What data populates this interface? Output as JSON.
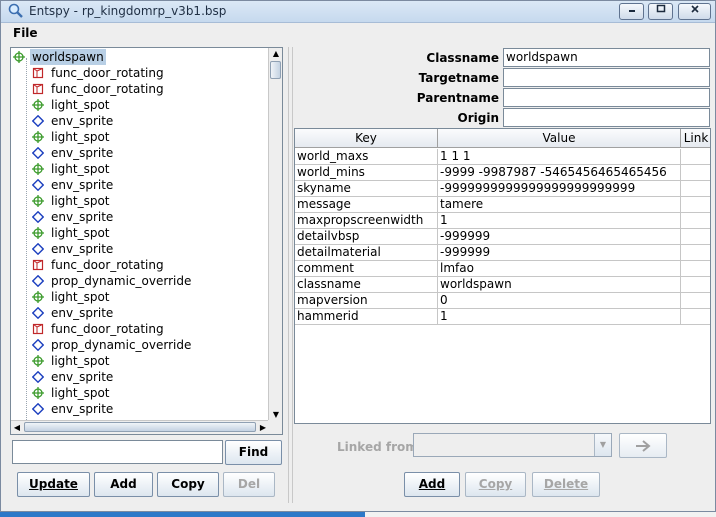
{
  "window": {
    "title": "Entspy - rp_kingdomrp_v3b1.bsp",
    "controls": [
      "minimize",
      "maximize",
      "close"
    ]
  },
  "menu": {
    "file": "File"
  },
  "tree": {
    "root": "worldspawn",
    "items": [
      {
        "label": "func_door_rotating",
        "icon": "door-icon"
      },
      {
        "label": "func_door_rotating",
        "icon": "door-icon"
      },
      {
        "label": "light_spot",
        "icon": "crosshair-icon"
      },
      {
        "label": "env_sprite",
        "icon": "diamond-icon"
      },
      {
        "label": "light_spot",
        "icon": "crosshair-icon"
      },
      {
        "label": "env_sprite",
        "icon": "diamond-icon"
      },
      {
        "label": "light_spot",
        "icon": "crosshair-icon"
      },
      {
        "label": "env_sprite",
        "icon": "diamond-icon"
      },
      {
        "label": "light_spot",
        "icon": "crosshair-icon"
      },
      {
        "label": "env_sprite",
        "icon": "diamond-icon"
      },
      {
        "label": "light_spot",
        "icon": "crosshair-icon"
      },
      {
        "label": "env_sprite",
        "icon": "diamond-icon"
      },
      {
        "label": "func_door_rotating",
        "icon": "door-icon"
      },
      {
        "label": "prop_dynamic_override",
        "icon": "diamond-icon"
      },
      {
        "label": "light_spot",
        "icon": "crosshair-icon"
      },
      {
        "label": "env_sprite",
        "icon": "diamond-icon"
      },
      {
        "label": "func_door_rotating",
        "icon": "door-icon"
      },
      {
        "label": "prop_dynamic_override",
        "icon": "diamond-icon"
      },
      {
        "label": "light_spot",
        "icon": "crosshair-icon"
      },
      {
        "label": "env_sprite",
        "icon": "diamond-icon"
      },
      {
        "label": "light_spot",
        "icon": "crosshair-icon"
      },
      {
        "label": "env_sprite",
        "icon": "diamond-icon"
      }
    ]
  },
  "search": {
    "value": "",
    "find_label": "Find"
  },
  "left_buttons": {
    "update": "Update",
    "add": "Add",
    "copy": "Copy",
    "del": "Del"
  },
  "properties": {
    "classname_label": "Classname",
    "classname_value": "worldspawn",
    "targetname_label": "Targetname",
    "targetname_value": "",
    "parentname_label": "Parentname",
    "parentname_value": "",
    "origin_label": "Origin",
    "origin_value": ""
  },
  "table": {
    "headers": {
      "key": "Key",
      "value": "Value",
      "link": "Link"
    },
    "rows": [
      {
        "key": "world_maxs",
        "value": "1 1 1"
      },
      {
        "key": "world_mins",
        "value": "-9999 -9987987 -5465456465465456"
      },
      {
        "key": "skyname",
        "value": "-9999999999999999999999999"
      },
      {
        "key": "message",
        "value": "tamere"
      },
      {
        "key": "maxpropscreenwidth",
        "value": "1"
      },
      {
        "key": "detailvbsp",
        "value": "-999999"
      },
      {
        "key": "detailmaterial",
        "value": "-999999"
      },
      {
        "key": "comment",
        "value": "lmfao"
      },
      {
        "key": "classname",
        "value": "worldspawn"
      },
      {
        "key": "mapversion",
        "value": "0"
      },
      {
        "key": "hammerid",
        "value": "1"
      }
    ]
  },
  "linked": {
    "label": "Linked from",
    "value": ""
  },
  "right_buttons": {
    "add": "Add",
    "copy": "Copy",
    "delete": "Delete"
  },
  "colors": {
    "selection": "#b8cfe5",
    "door_icon": "#c0282a",
    "light_icon": "#3a9a2a",
    "sprite_icon": "#1c3fbf"
  }
}
